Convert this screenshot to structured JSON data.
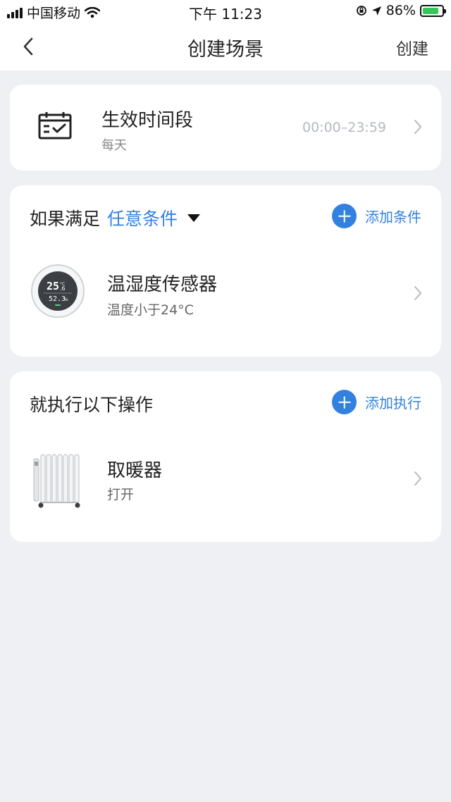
{
  "status_bar": {
    "carrier": "中国移动",
    "time": "下午 11:23",
    "battery_percent": "86%",
    "battery_level": 0.86
  },
  "nav": {
    "title": "创建场景",
    "action_label": "创建"
  },
  "effective_period": {
    "title": "生效时间段",
    "repeat": "每天",
    "time_range": "00:00–23:59",
    "icon": "calendar-check-icon"
  },
  "condition": {
    "prefix": "如果满足",
    "mode": "任意条件",
    "add_label": "添加条件",
    "items": [
      {
        "name": "温湿度传感器",
        "detail": "温度小于24°C",
        "icon": "temperature-humidity-sensor-icon",
        "display_temp": "25",
        "display_temp_decimal": ".6",
        "display_temp_unit": "°C",
        "display_humidity": "52.3",
        "display_humidity_unit": "%"
      }
    ]
  },
  "action": {
    "title": "就执行以下操作",
    "add_label": "添加执行",
    "items": [
      {
        "name": "取暖器",
        "detail": "打开",
        "icon": "oil-heater-icon"
      }
    ]
  },
  "colors": {
    "accent": "#3281df",
    "background": "#eef0f4",
    "card": "#ffffff"
  }
}
